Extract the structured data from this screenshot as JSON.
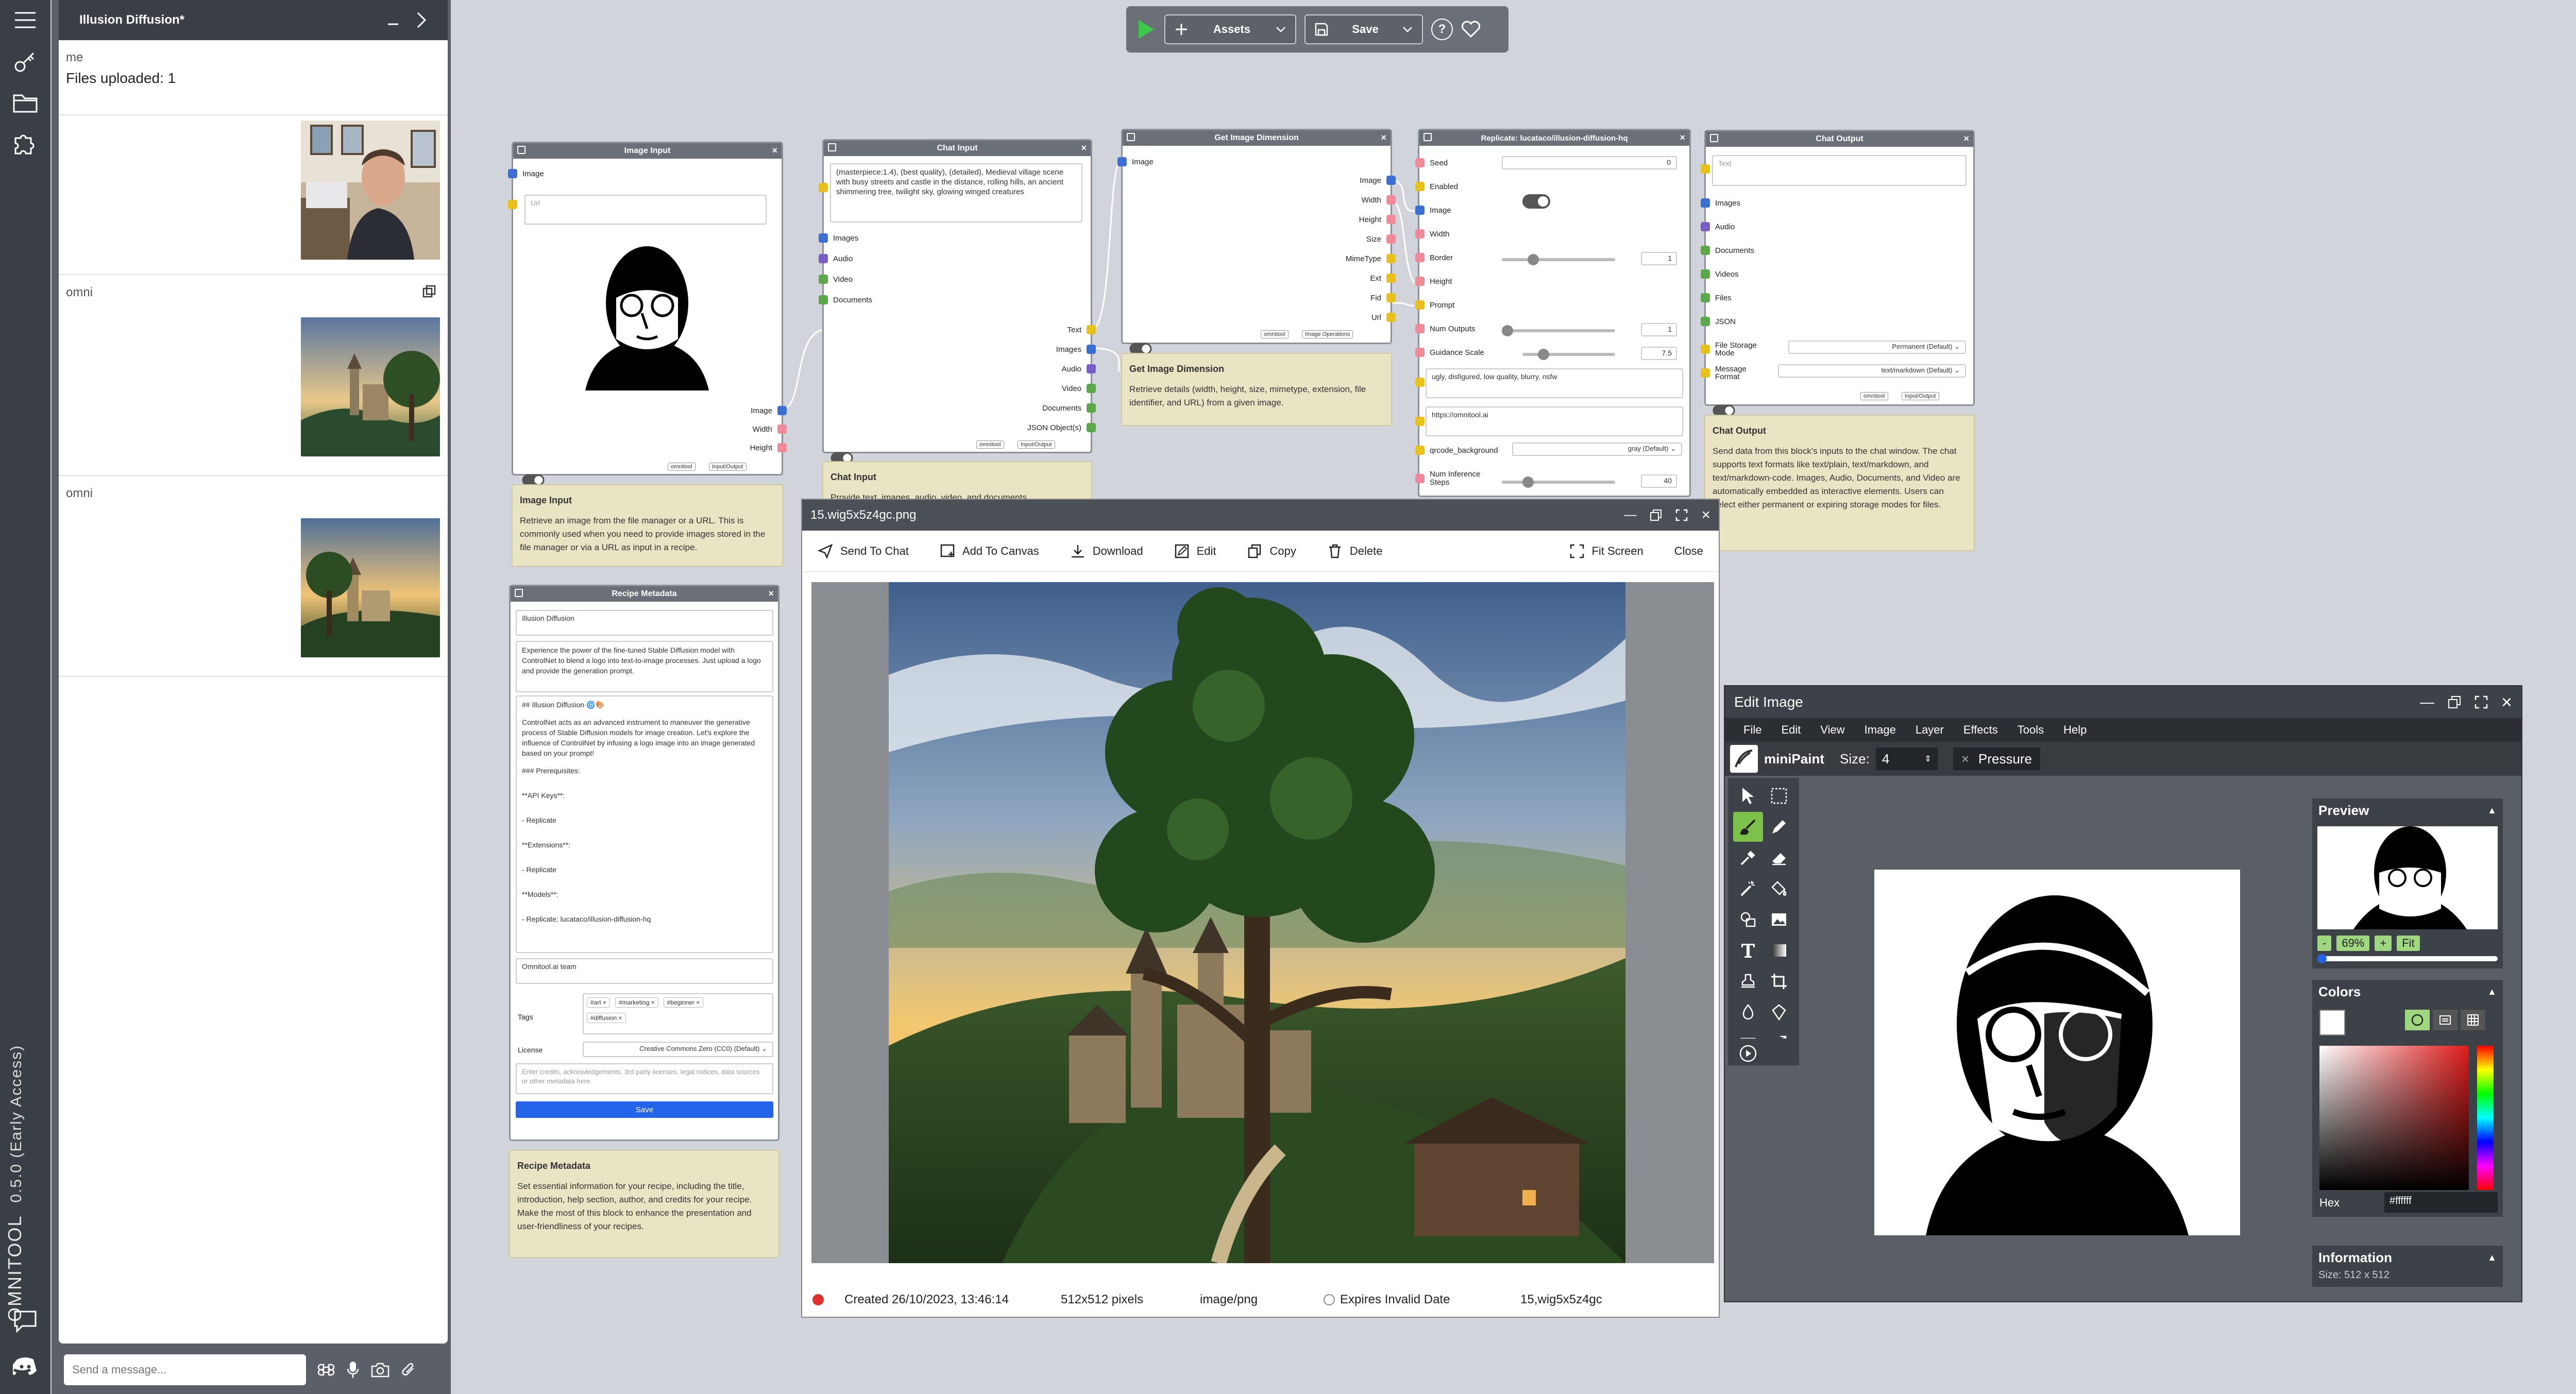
{
  "app": {
    "brand": "OMNITOOL",
    "version": "0.5.0 (Early Access)"
  },
  "chat": {
    "title": "Illusion Diffusion*",
    "messages": [
      {
        "who": "me",
        "text": "Files uploaded: 1"
      },
      {
        "who": "omni",
        "text": ""
      },
      {
        "who": "omni",
        "text": ""
      }
    ],
    "input_placeholder": "Send a message..."
  },
  "toolbar": {
    "assets_label": "Assets",
    "save_label": "Save",
    "help": "?"
  },
  "nodes": {
    "image_input": {
      "title": "Image Input",
      "port_in": "Image",
      "url_placeholder": "Url",
      "ports_out": [
        "Image",
        "Width",
        "Height"
      ],
      "badges": [
        "omnitool",
        "Input/Output"
      ],
      "info_title": "Image Input",
      "info_text": "Retrieve an image from the file manager or a URL. This is commonly used when you need to provide images stored in the file manager or via a URL as input in a recipe."
    },
    "chat_input": {
      "title": "Chat Input",
      "prompt": "(masterpiece:1.4), (best quality), (detailed), Medieval village scene with busy streets and castle in the distance, rolling hills, an ancient shimmering tree, twilight sky, glowing winged creatures",
      "ports_in": [
        "Images",
        "Audio",
        "Video",
        "Documents"
      ],
      "ports_out": [
        "Text",
        "Images",
        "Audio",
        "Video",
        "Documents",
        "JSON Object(s)"
      ],
      "badges": [
        "omnitool",
        "Input/Output"
      ],
      "info_title": "Chat Input",
      "info_text": "Provide text, images, audio, video, and documents"
    },
    "get_image_dimension": {
      "title": "Get Image Dimension",
      "port_in": "Image",
      "ports_out": [
        "Image",
        "Width",
        "Height",
        "Size",
        "MimeType",
        "Ext",
        "Fid",
        "Url"
      ],
      "badges": [
        "omnitool",
        "Image Operations"
      ],
      "info_title": "Get Image Dimension",
      "info_text": "Retrieve details (width, height, size, mimetype, extension, file identifier, and URL) from a given image."
    },
    "replicate": {
      "title": "Replicate: lucataco/illusion-diffusion-hq",
      "fields": [
        {
          "label": "Seed",
          "value": "0"
        },
        {
          "label": "Enabled",
          "value": ""
        },
        {
          "label": "Image",
          "value": ""
        },
        {
          "label": "Width",
          "value": ""
        },
        {
          "label": "Border",
          "value": "1"
        },
        {
          "label": "Height",
          "value": ""
        },
        {
          "label": "Prompt",
          "value": ""
        },
        {
          "label": "Num Outputs",
          "value": "1"
        },
        {
          "label": "Guidance Scale",
          "value": "7.5"
        }
      ],
      "negative": "ugly, disfigured, low quality, blurry, nsfw",
      "url": "https://omnitool.ai",
      "qrcode_label": "qrcode_background",
      "qrcode_value": "gray (Default)",
      "steps_label": "Num Inference Steps",
      "steps_value": "40"
    },
    "chat_output": {
      "title": "Chat Output",
      "text_placeholder": "Text",
      "ports_in": [
        "Images",
        "Audio",
        "Documents",
        "Videos",
        "Files",
        "JSON"
      ],
      "storage_label": "File Storage Mode",
      "storage_value": "Permanent (Default)",
      "format_label": "Message Format",
      "format_value": "text/markdown (Default)",
      "badges": [
        "omnitool",
        "Input/Output"
      ],
      "info_title": "Chat Output",
      "info_text": "Send data from this block's inputs to the chat window. The chat supports text formats like text/plain, text/markdown, and text/markdown-code. Images, Audio, Documents, and Video are automatically embedded as interactive elements. Users can select either permanent or expiring storage modes for files."
    },
    "recipe_metadata": {
      "title": "Recipe Metadata",
      "name": "Illusion Diffusion",
      "intro": "Experience the power of the fine-tuned Stable Diffusion model with ControlNet to blend a logo into text-to-image processes. Just upload a logo and provide the generation prompt.",
      "help_lines": [
        "## Illusion Diffusion 🌀🎨",
        "ControlNet acts as an advanced instrument to maneuver the generative process of Stable Diffusion models for image creation. Let's explore the influence of ControlNet by infusing a logo image into an image generated based on your prompt!",
        "### Prerequisites:",
        "**API Keys**:",
        "- Replicate",
        "**Extensions**:",
        "- Replicate",
        "**Models**:",
        "- Replicate: lucataco/illusion-diffusion-hq"
      ],
      "author": "Omnitool.ai team",
      "tags_label": "Tags",
      "tags": [
        "#art",
        "#marketing",
        "#beginner",
        "#diffusion"
      ],
      "license_label": "License",
      "license_value": "Creative Commons Zero (CC0) (Default)",
      "credits_placeholder": "Enter credits, acknowledgements, 3rd party licenses, legal notices, data sources or other metadata here.",
      "save_label": "Save",
      "info_title": "Recipe Metadata",
      "info_text": "Set essential information for your recipe, including the title, introduction, help section, author, and credits for your recipe. Make the most of this block to enhance the presentation and user-friendliness of your recipes."
    }
  },
  "viewer": {
    "filename": "15.wig5x5z4gc.png",
    "tools": [
      "Send To Chat",
      "Add To Canvas",
      "Download",
      "Edit",
      "Copy",
      "Delete"
    ],
    "fullscreen": "Fit Screen",
    "close": "Close",
    "footer": {
      "created": "Created 26/10/2023, 13:46:14",
      "size": "512x512 pixels",
      "mime": "image/png",
      "expires": "Expires Invalid Date",
      "id": "15,wig5x5z4gc"
    }
  },
  "editor": {
    "title": "Edit Image",
    "menu": [
      "File",
      "Edit",
      "View",
      "Image",
      "Layer",
      "Effects",
      "Tools",
      "Help"
    ],
    "app_name": "miniPaint",
    "size_label": "Size:",
    "size_value": "4",
    "pressure": "Pressure",
    "preview_title": "Preview",
    "zoom": "69%",
    "zoom_minus": "-",
    "zoom_plus": "+",
    "fit": "Fit",
    "colors_title": "Colors",
    "hex_label": "Hex",
    "hex_value": "#ffffff",
    "info_title": "Information",
    "info_partial": "Size: 512 x 512"
  },
  "colors": {
    "port_blue": "#3b6fd4",
    "port_yellow": "#e8c21b",
    "port_red": "#f08a98",
    "port_purple": "#7a5cc9",
    "port_green": "#5aa84a",
    "accent": "#2563eb"
  }
}
